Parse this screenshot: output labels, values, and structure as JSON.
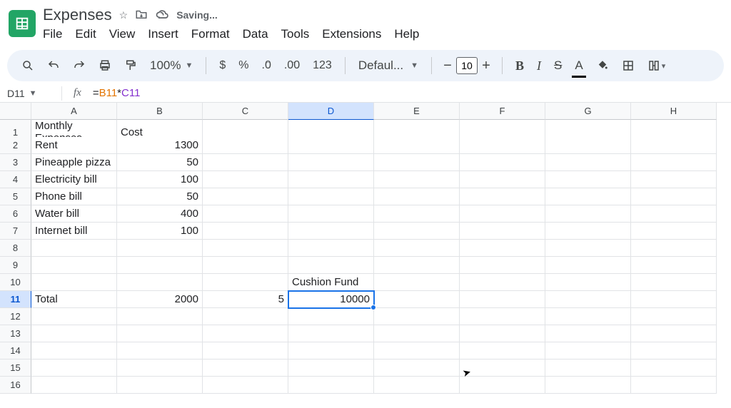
{
  "doc": {
    "title": "Expenses",
    "saving": "Saving..."
  },
  "menu": {
    "file": "File",
    "edit": "Edit",
    "view": "View",
    "insert": "Insert",
    "format": "Format",
    "data": "Data",
    "tools": "Tools",
    "extensions": "Extensions",
    "help": "Help"
  },
  "toolbar": {
    "zoom": "100%",
    "currency": "$",
    "percent": "%",
    "dec_dec": ".0",
    "inc_dec": ".00",
    "num_fmt": "123",
    "font": "Defaul...",
    "font_size": "10"
  },
  "namebox": "D11",
  "formula": {
    "eq": "=",
    "ref1": "B11",
    "op": "*",
    "ref2": "C11"
  },
  "columns": [
    "A",
    "B",
    "C",
    "D",
    "E",
    "F",
    "G",
    "H"
  ],
  "cells": {
    "A1": "Monthly Expenses",
    "B1": "Cost",
    "A2": "Rent",
    "B2": "1300",
    "A3": "Pineapple pizza",
    "B3": "50",
    "A4": "Electricity bill",
    "B4": "100",
    "A5": "Phone bill",
    "B5": "50",
    "A6": "Water bill",
    "B6": "400",
    "A7": "Internet bill",
    "B7": "100",
    "D10": "Cushion Fund",
    "A11": "Total",
    "B11": "2000",
    "C11": "5",
    "D11": "10000"
  },
  "selected_col": "D",
  "selected_row": 11,
  "row_count": 16
}
